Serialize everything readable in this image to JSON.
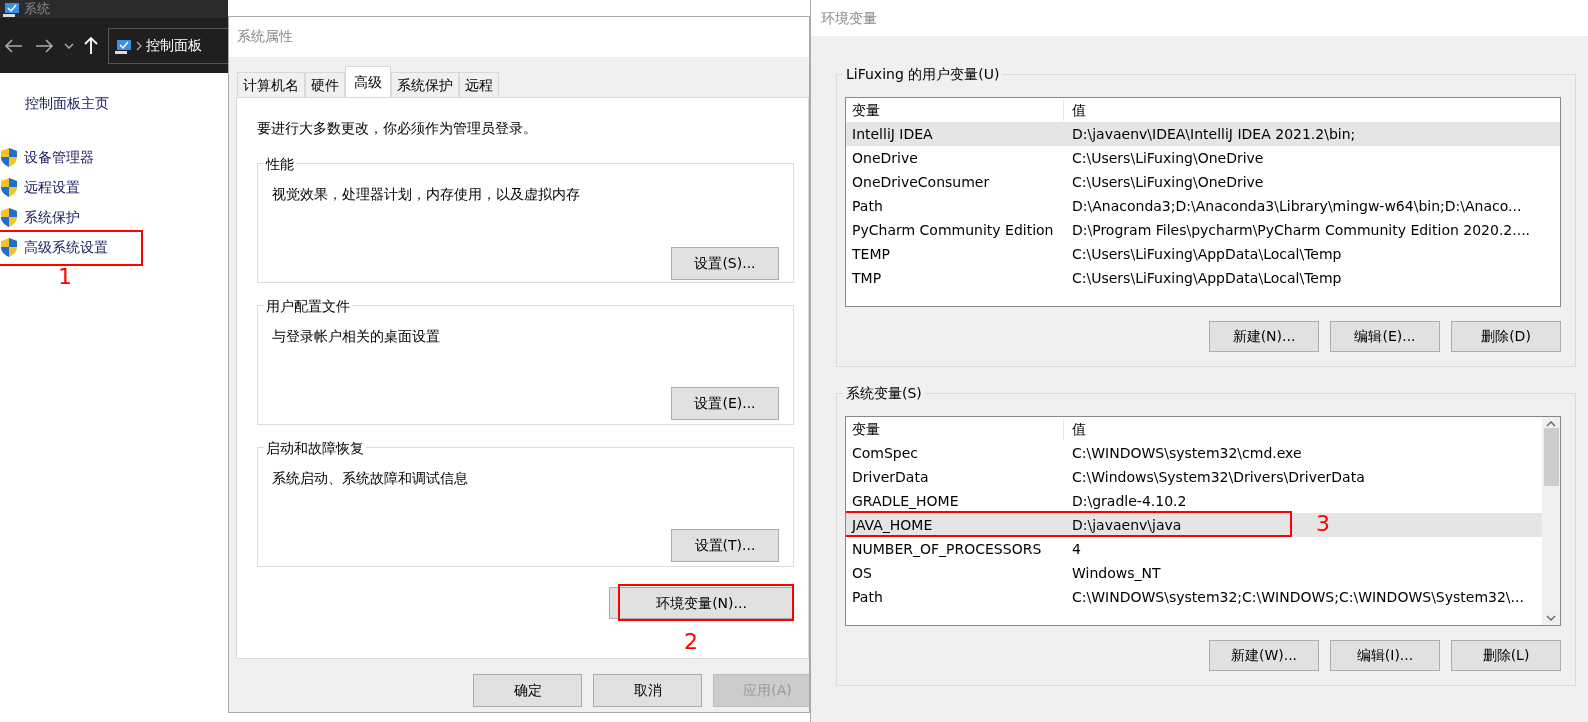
{
  "explorer": {
    "title": "系统",
    "address": "控制面板",
    "home_link": "控制面板主页",
    "links": [
      {
        "label": "设备管理器",
        "highlighted": false
      },
      {
        "label": "远程设置",
        "highlighted": false
      },
      {
        "label": "系统保护",
        "highlighted": false
      },
      {
        "label": "高级系统设置",
        "highlighted": true,
        "callout": "1"
      }
    ]
  },
  "system_properties": {
    "title": "系统属性",
    "tabs": [
      {
        "label": "计算机名",
        "selected": false
      },
      {
        "label": "硬件",
        "selected": false
      },
      {
        "label": "高级",
        "selected": true
      },
      {
        "label": "系统保护",
        "selected": false
      },
      {
        "label": "远程",
        "selected": false
      }
    ],
    "notice": "要进行大多数更改，你必须作为管理员登录。",
    "groups": [
      {
        "title": "性能",
        "description": "视觉效果，处理器计划，内存使用，以及虚拟内存",
        "button": "设置(S)..."
      },
      {
        "title": "用户配置文件",
        "description": "与登录帐户相关的桌面设置",
        "button": "设置(E)..."
      },
      {
        "title": "启动和故障恢复",
        "description": "系统启动、系统故障和调试信息",
        "button": "设置(T)..."
      }
    ],
    "env_button": {
      "label": "环境变量(N)...",
      "highlighted": true,
      "callout": "2"
    },
    "buttons": [
      {
        "label": "确定",
        "disabled": false
      },
      {
        "label": "取消",
        "disabled": false
      },
      {
        "label": "应用(A)",
        "disabled": true
      }
    ]
  },
  "environment_variables": {
    "title": "环境变量",
    "user_group": {
      "title": "LiFuxing 的用户变量(U)",
      "columns": [
        "变量",
        "值"
      ],
      "rows": [
        {
          "name": "IntelliJ IDEA",
          "value": "D:\\javaenv\\IDEA\\IntelliJ IDEA 2021.2\\bin;",
          "selected": true,
          "highlighted": false
        },
        {
          "name": "OneDrive",
          "value": "C:\\Users\\LiFuxing\\OneDrive",
          "selected": false,
          "highlighted": false
        },
        {
          "name": "OneDriveConsumer",
          "value": "C:\\Users\\LiFuxing\\OneDrive",
          "selected": false,
          "highlighted": false
        },
        {
          "name": "Path",
          "value": "D:\\Anaconda3;D:\\Anaconda3\\Library\\mingw-w64\\bin;D:\\Anaco...",
          "selected": false,
          "highlighted": false
        },
        {
          "name": "PyCharm Community Edition",
          "value": "D:\\Program Files\\pycharm\\PyCharm Community Edition 2020.2....",
          "selected": false,
          "highlighted": false
        },
        {
          "name": "TEMP",
          "value": "C:\\Users\\LiFuxing\\AppData\\Local\\Temp",
          "selected": false,
          "highlighted": false
        },
        {
          "name": "TMP",
          "value": "C:\\Users\\LiFuxing\\AppData\\Local\\Temp",
          "selected": false,
          "highlighted": false
        }
      ],
      "buttons": [
        "新建(N)...",
        "编辑(E)...",
        "删除(D)"
      ]
    },
    "system_group": {
      "title": "系统变量(S)",
      "columns": [
        "变量",
        "值"
      ],
      "rows": [
        {
          "name": "ComSpec",
          "value": "C:\\WINDOWS\\system32\\cmd.exe",
          "selected": false,
          "highlighted": false
        },
        {
          "name": "DriverData",
          "value": "C:\\Windows\\System32\\Drivers\\DriverData",
          "selected": false,
          "highlighted": false
        },
        {
          "name": "GRADLE_HOME",
          "value": "D:\\gradle-4.10.2",
          "selected": false,
          "highlighted": false
        },
        {
          "name": "JAVA_HOME",
          "value": "D:\\javaenv\\java",
          "selected": true,
          "highlighted": true,
          "callout": "3"
        },
        {
          "name": "NUMBER_OF_PROCESSORS",
          "value": "4",
          "selected": false,
          "highlighted": false
        },
        {
          "name": "OS",
          "value": "Windows_NT",
          "selected": false,
          "highlighted": false
        },
        {
          "name": "Path",
          "value": "C:\\WINDOWS\\system32;C:\\WINDOWS;C:\\WINDOWS\\System32\\...",
          "selected": false,
          "highlighted": false
        }
      ],
      "buttons": [
        "新建(W)...",
        "编辑(I)...",
        "删除(L)"
      ]
    }
  }
}
